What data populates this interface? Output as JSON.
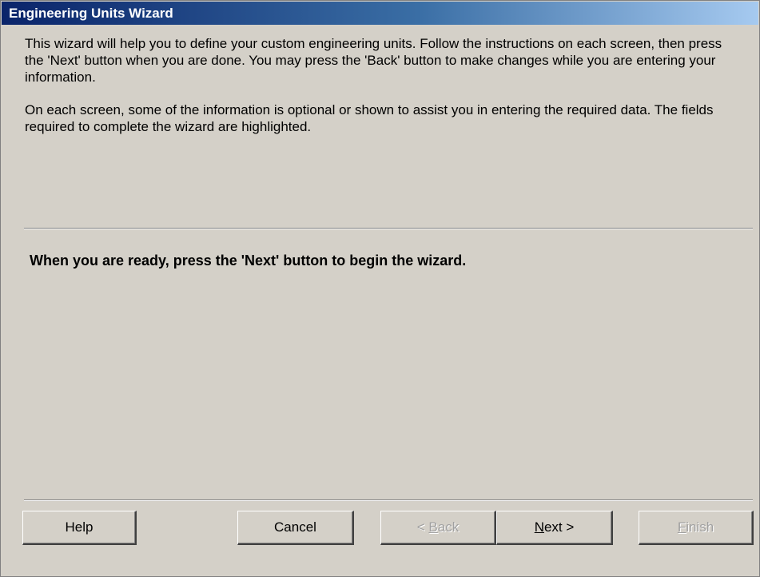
{
  "window": {
    "title": "Engineering Units Wizard"
  },
  "intro": {
    "paragraph1": "This wizard will help you to define your custom engineering units. Follow the instructions on each screen, then press the 'Next' button when you are done. You may press the 'Back' button to make changes while you are entering your information.",
    "paragraph2": "On each screen, some of the information is optional or shown to assist you in entering the required data. The fields required to complete the wizard are highlighted."
  },
  "ready_message": "When you are ready, press the 'Next' button to begin the wizard.",
  "buttons": {
    "help": {
      "label": "Help",
      "enabled": true
    },
    "cancel": {
      "label": "Cancel",
      "enabled": true
    },
    "back": {
      "prefix": "< ",
      "mnemonic": "B",
      "rest": "ack",
      "enabled": false
    },
    "next": {
      "mnemonic": "N",
      "rest": "ext >",
      "enabled": true
    },
    "finish": {
      "mnemonic": "F",
      "rest": "inish",
      "enabled": false
    }
  },
  "colors": {
    "face": "#d4d0c8",
    "title_start": "#0a246a",
    "title_end": "#a6caf0",
    "disabled_text": "#a0a0a0"
  }
}
